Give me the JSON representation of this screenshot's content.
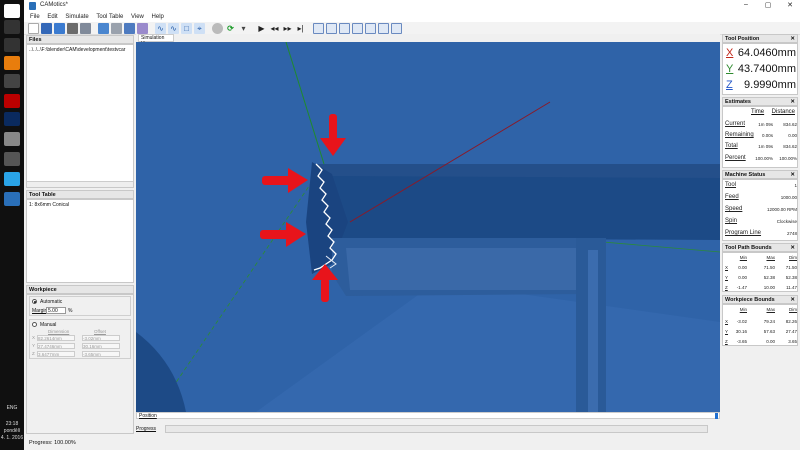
{
  "app": {
    "title": "CAMotics*",
    "menu": [
      "File",
      "Edit",
      "Simulate",
      "Tool Table",
      "View",
      "Help"
    ],
    "window_controls": [
      "–",
      "▢",
      "✕"
    ]
  },
  "toolbar": {
    "icons": [
      "new-icon",
      "save-icon",
      "import-icon",
      "export-icon",
      "layers-icon",
      "grid-icon",
      "path-icon",
      "surface-icon",
      "wave-icon",
      "tool-icon",
      "axes-icon",
      "stop-icon",
      "reload-icon",
      "play-icon",
      "step-icon",
      "fast-forward-icon",
      "end-icon",
      "view-iso-icon",
      "view-front-icon",
      "view-top-icon",
      "view-left-icon",
      "view-right-icon",
      "view-back-icon",
      "view-bottom-icon"
    ]
  },
  "files": {
    "header": "Files",
    "path": "..\\..\\..\\F:\\blender\\CAM\\development\\testvcar"
  },
  "tool_table": {
    "header": "Tool Table",
    "items": [
      "1: 8x6mm Conical"
    ]
  },
  "workpiece": {
    "header": "Workpiece",
    "automatic_label": "Automatic",
    "margin_label": "Margin",
    "margin_value": "5.00",
    "percent": "%",
    "manual_label": "Manual",
    "col_dimension": "Dimension",
    "col_offset": "Offset",
    "rows": [
      {
        "axis": "X",
        "dimension": "82.2614mm",
        "offset": "-3.02mm"
      },
      {
        "axis": "Y",
        "dimension": "27.4746mm",
        "offset": "30.16mm"
      },
      {
        "axis": "Z",
        "dimension": "3.6477mm",
        "offset": "-3.65mm"
      }
    ]
  },
  "sim": {
    "tab": "Simulation View",
    "position_label": "Position",
    "progress_label": "Progress"
  },
  "status": "Progress: 100.00%",
  "tool_position": {
    "header": "Tool Position",
    "axes": [
      {
        "axis": "X",
        "value": "64.0460mm",
        "color": "#c0271a"
      },
      {
        "axis": "Y",
        "value": "43.7400mm",
        "color": "#2e8a2e"
      },
      {
        "axis": "Z",
        "value": "9.9990mm",
        "color": "#2256c8"
      }
    ]
  },
  "estimates": {
    "header": "Estimates",
    "col_time": "Time",
    "col_distance": "Distance",
    "rows": [
      {
        "label": "Current",
        "time": "1m 09s",
        "distance": "834.62"
      },
      {
        "label": "Remaining",
        "time": "0.00s",
        "distance": "0.00"
      },
      {
        "label": "Total",
        "time": "1m 09s",
        "distance": "834.62"
      },
      {
        "label": "Percent",
        "time": "100.00%",
        "distance": "100.00%"
      }
    ]
  },
  "machine_status": {
    "header": "Machine Status",
    "rows": [
      {
        "label": "Tool",
        "value": "1"
      },
      {
        "label": "Feed",
        "value": "1000.00"
      },
      {
        "label": "Speed",
        "value": "12000.00 RPM"
      },
      {
        "label": "Spin",
        "value": "Clockwise"
      },
      {
        "label": "Program Line",
        "value": "2748"
      }
    ]
  },
  "tool_path_bounds": {
    "header": "Tool Path Bounds",
    "cols": [
      "Min",
      "Max",
      "Dim"
    ],
    "rows": [
      {
        "axis": "X",
        "min": "0.00",
        "max": "71.50",
        "dim": "71.50"
      },
      {
        "axis": "Y",
        "min": "0.00",
        "max": "52.38",
        "dim": "52.38"
      },
      {
        "axis": "Z",
        "min": "-1.47",
        "max": "10.00",
        "dim": "11.47"
      }
    ]
  },
  "workpiece_bounds": {
    "header": "Workpiece Bounds",
    "cols": [
      "Min",
      "Max",
      "Dim"
    ],
    "rows": [
      {
        "axis": "X",
        "min": "-3.02",
        "max": "79.24",
        "dim": "82.26"
      },
      {
        "axis": "Y",
        "min": "30.16",
        "max": "57.63",
        "dim": "27.47"
      },
      {
        "axis": "Z",
        "min": "-3.65",
        "max": "0.00",
        "dim": "3.65"
      }
    ]
  },
  "clock": {
    "lang": "ENG",
    "time": "23:18",
    "day": "pondělí",
    "date": "4. 1. 2016"
  },
  "colors": {
    "sim_bg": "#2e62a6",
    "model": "#1c4a86",
    "arrow": "#e8141b"
  }
}
